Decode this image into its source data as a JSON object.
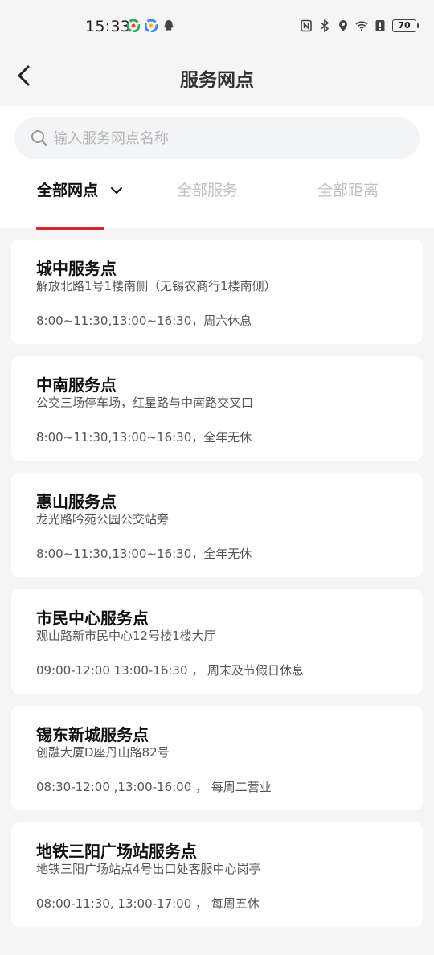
{
  "status_bar": {
    "time": "15:33",
    "battery": "70",
    "icons": [
      "app-icon-1",
      "app-icon-2",
      "qq-icon",
      "nfc-icon",
      "bluetooth-icon",
      "location-icon",
      "wifi-icon",
      "alert-icon",
      "battery-icon"
    ]
  },
  "header": {
    "title": "服务网点",
    "back_icon": "back-chevron-icon"
  },
  "search": {
    "placeholder": "输入服务网点名称",
    "value": ""
  },
  "tabs": [
    {
      "label": "全部网点",
      "active": true
    },
    {
      "label": "全部服务",
      "active": false
    },
    {
      "label": "全部距离",
      "active": false
    }
  ],
  "colors": {
    "accent": "#d42a2f",
    "background": "#f5f5f5",
    "card": "#ffffff",
    "inactive_tab": "#c0c0c0"
  },
  "service_points": [
    {
      "name": "城中服务点",
      "address": "解放北路1号1楼南侧（无锡农商行1楼南侧）",
      "hours": "8:00~11:30,13:00~16:30，周六休息"
    },
    {
      "name": "中南服务点",
      "address": "公交三场停车场，红星路与中南路交叉口",
      "hours": "8:00~11:30,13:00~16:30，全年无休"
    },
    {
      "name": "惠山服务点",
      "address": "龙光路吟苑公园公交站旁",
      "hours": "8:00~11:30,13:00~16:30，全年无休"
    },
    {
      "name": "市民中心服务点",
      "address": "观山路新市民中心12号楼1楼大厅",
      "hours": "09:00-12:00 13:00-16:30 ， 周末及节假日休息"
    },
    {
      "name": "锡东新城服务点",
      "address": "创融大厦D座丹山路82号",
      "hours": "08:30-12:00 ,13:00-16:00 ， 每周二营业"
    },
    {
      "name": "地铁三阳广场站服务点",
      "address": "地铁三阳广场站点4号出口处客服中心岗亭",
      "hours": "08:00-11:30, 13:00-17:00 ， 每周五休"
    }
  ]
}
